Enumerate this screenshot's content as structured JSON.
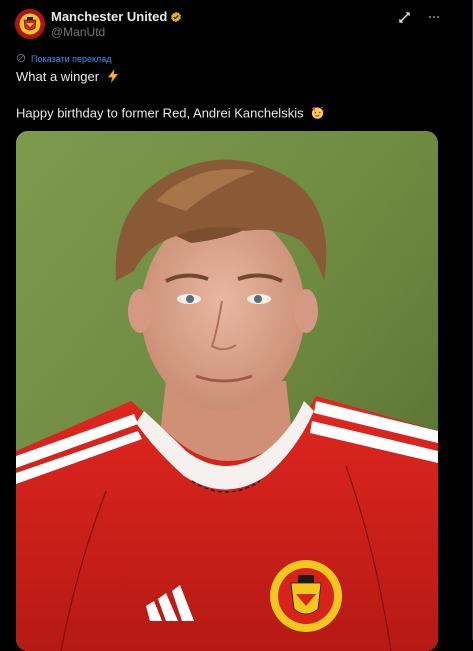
{
  "author": {
    "name": "Manchester United",
    "handle": "@ManUtd",
    "avatar_icon": "club-crest-icon",
    "verified_icon": "verified-badge-icon"
  },
  "actions": {
    "grok_icon": "grok-icon",
    "more_icon": "more-icon"
  },
  "translate": {
    "label": "Показати переклад",
    "icon": "translate-icon"
  },
  "tweet": {
    "line1": "What a winger",
    "line1_emoji": "lightning-icon",
    "line2": "Happy birthday to former Red, Andrei Kanchelskis",
    "line2_emoji": "party-face-icon"
  },
  "media": {
    "alt": "photo",
    "kit_brand_text": "adidas",
    "crest_text": "MANCHESTER UNITED FOOTBALL CLUB"
  },
  "colors": {
    "accent": "#1d9bf0",
    "verified": "#e2b719",
    "shirt_red": "#d9221e"
  }
}
